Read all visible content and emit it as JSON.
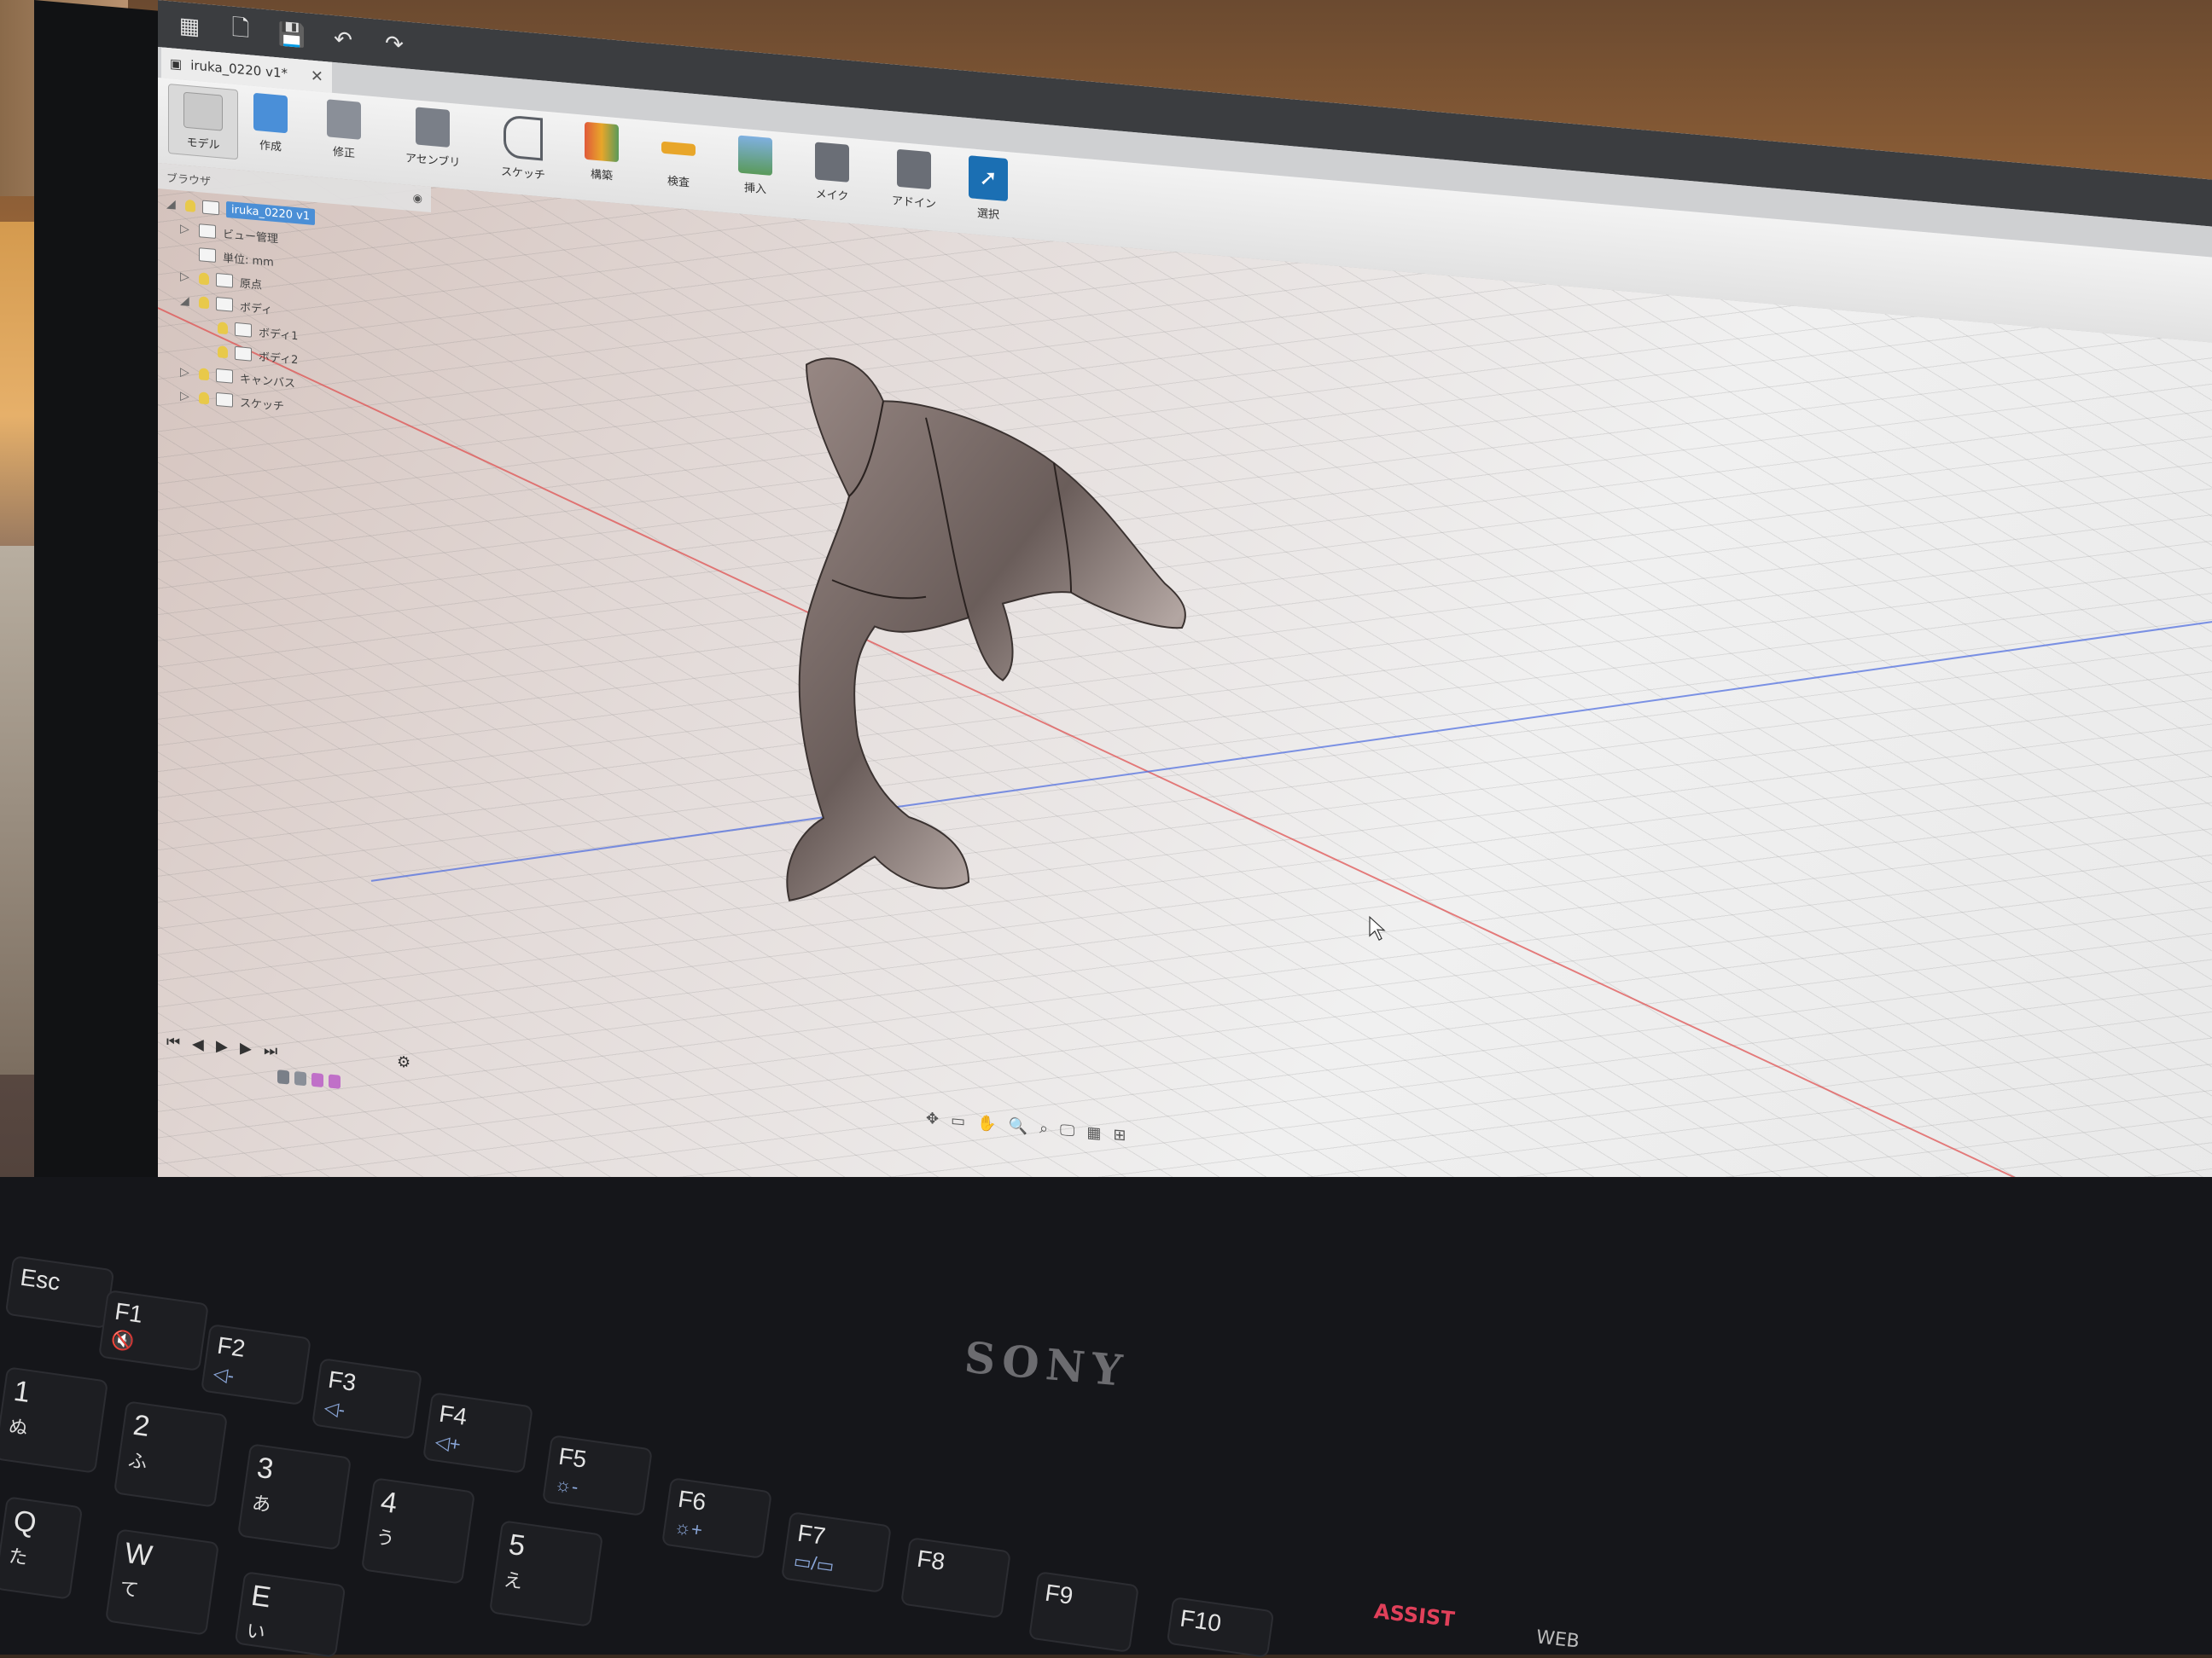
{
  "document": {
    "tab_title": "iruka_0220 v1*"
  },
  "ribbon": {
    "workspace": "モデル",
    "tools": [
      {
        "id": "create",
        "label": "作成",
        "color": "#4a8fd8"
      },
      {
        "id": "modify",
        "label": "修正",
        "color": "#8a8f98"
      },
      {
        "id": "assemble",
        "label": "アセンブリ",
        "color": "#7a7f88"
      },
      {
        "id": "sketch",
        "label": "スケッチ",
        "color": "#5b5f66"
      },
      {
        "id": "construct",
        "label": "構築",
        "color": "#e05a3a"
      },
      {
        "id": "inspect",
        "label": "検査",
        "color": "#e8a62a"
      },
      {
        "id": "insert",
        "label": "挿入",
        "color": "#5a9a5a"
      },
      {
        "id": "make",
        "label": "メイク",
        "color": "#6a6e76"
      },
      {
        "id": "addins",
        "label": "アドイン",
        "color": "#6a6e76"
      },
      {
        "id": "select",
        "label": "選択",
        "color": "#1b6fb3"
      }
    ]
  },
  "browser": {
    "header": "ブラウザ",
    "root": "iruka_0220 v1",
    "nodes": [
      {
        "label": "ビュー管理",
        "depth": 1,
        "expander": "▷"
      },
      {
        "label": "単位: mm",
        "depth": 1,
        "expander": ""
      },
      {
        "label": "原点",
        "depth": 1,
        "expander": "▷"
      },
      {
        "label": "ボディ",
        "depth": 1,
        "expander": "◢"
      },
      {
        "label": "ボディ1",
        "depth": 2,
        "expander": ""
      },
      {
        "label": "ボディ2",
        "depth": 2,
        "expander": ""
      },
      {
        "label": "キャンバス",
        "depth": 1,
        "expander": "▷"
      },
      {
        "label": "スケッチ",
        "depth": 1,
        "expander": "▷"
      }
    ]
  },
  "timeline": {
    "controls": [
      "⏮",
      "◀",
      "▶",
      "▶",
      "⏭"
    ],
    "feature_colors": [
      "#7a7f88",
      "#8a8f98",
      "#c070c8",
      "#c070c8"
    ]
  },
  "viewport": {
    "model": "dolphin",
    "axis_colors": {
      "x": "#e04a4a",
      "y": "#4a6ae0"
    }
  },
  "navbar": {
    "icons": [
      "orbit-icon",
      "look-at-icon",
      "pan-icon",
      "zoom-icon",
      "fit-icon",
      "display-icon",
      "grid-icon",
      "viewports-icon"
    ]
  },
  "laptop": {
    "brand": "SONY",
    "assist": "ASSIST",
    "web": "WEB"
  },
  "keys": {
    "esc": "Esc",
    "f1": "F1",
    "f2": "F2",
    "f3": "F3",
    "f4": "F4",
    "f5": "F5",
    "f6": "F6",
    "f7": "F7",
    "f8": "F8",
    "f9": "F9",
    "f10": "F10",
    "k1": "1",
    "k1k": "ぬ",
    "k2": "2",
    "k2k": "ふ",
    "k3": "3",
    "k3k": "あ",
    "k4": "4",
    "k4k": "う",
    "k5": "5",
    "k5k": "え",
    "q": "Q",
    "qk": "た",
    "w": "W",
    "wk": "て",
    "e": "E",
    "ek": "い"
  }
}
